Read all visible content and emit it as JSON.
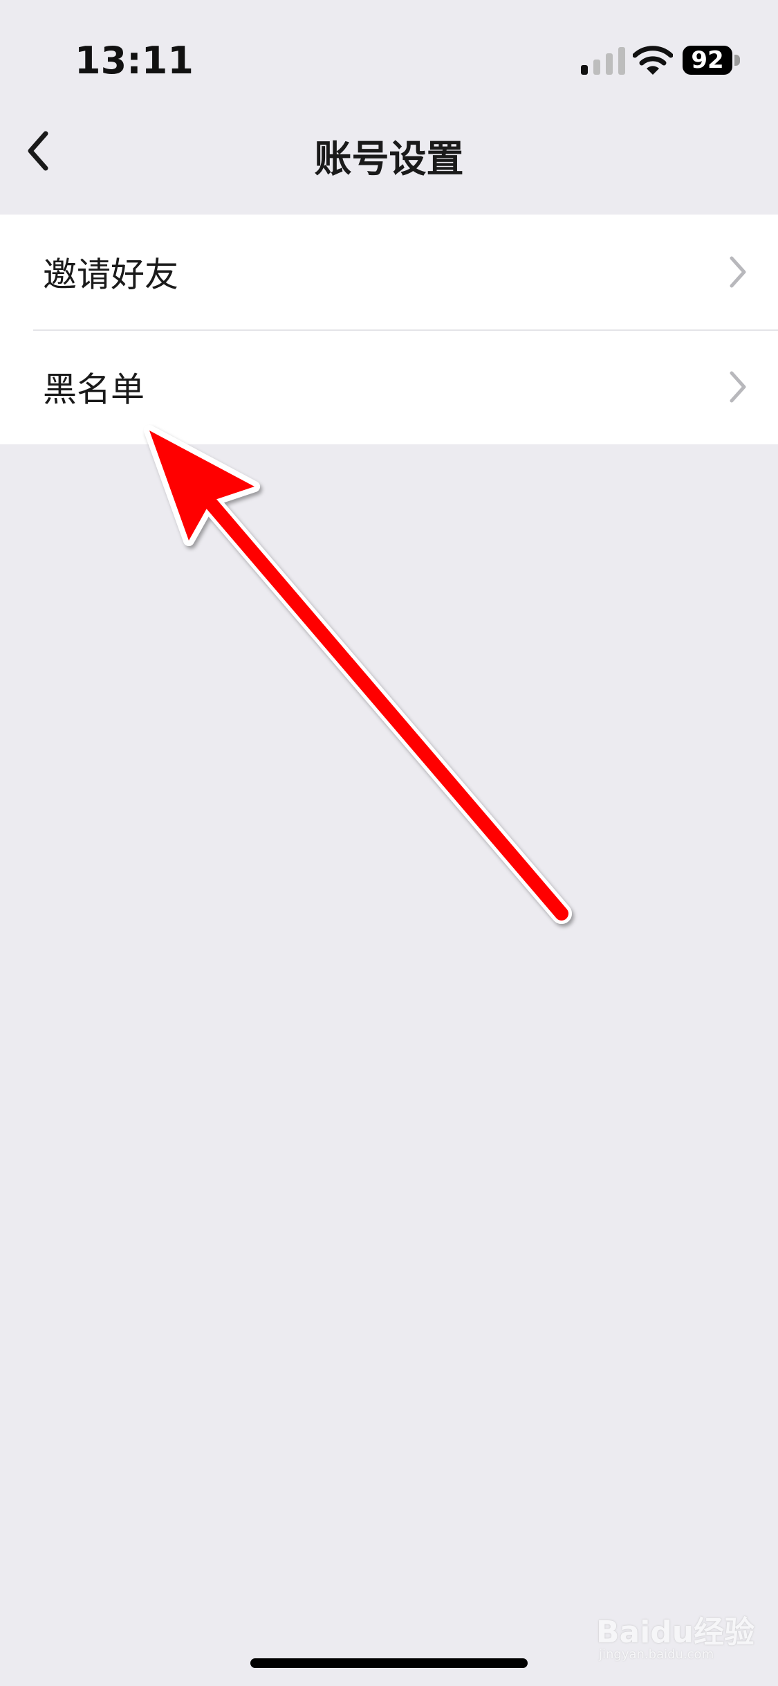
{
  "status_bar": {
    "time": "13:11",
    "battery_level": "92",
    "icons": [
      "signal-icon",
      "wifi-icon",
      "battery-icon"
    ]
  },
  "nav": {
    "title": "账号设置",
    "back_icon": "chevron-left-icon"
  },
  "menu": {
    "items": [
      {
        "label": "邀请好友",
        "icon": "chevron-right-icon"
      },
      {
        "label": "黑名单",
        "icon": "chevron-right-icon"
      }
    ]
  },
  "annotation": {
    "type": "red-arrow",
    "points_to": "黑名单",
    "color": "#ff0000"
  },
  "watermark": {
    "text": "Baidu经验",
    "sub": "jingyan.baidu.com"
  },
  "colors": {
    "background": "#ecebf0",
    "card": "#ffffff",
    "text": "#1a1a1a",
    "chevron": "#b8b8bc",
    "arrow": "#ff0000"
  }
}
